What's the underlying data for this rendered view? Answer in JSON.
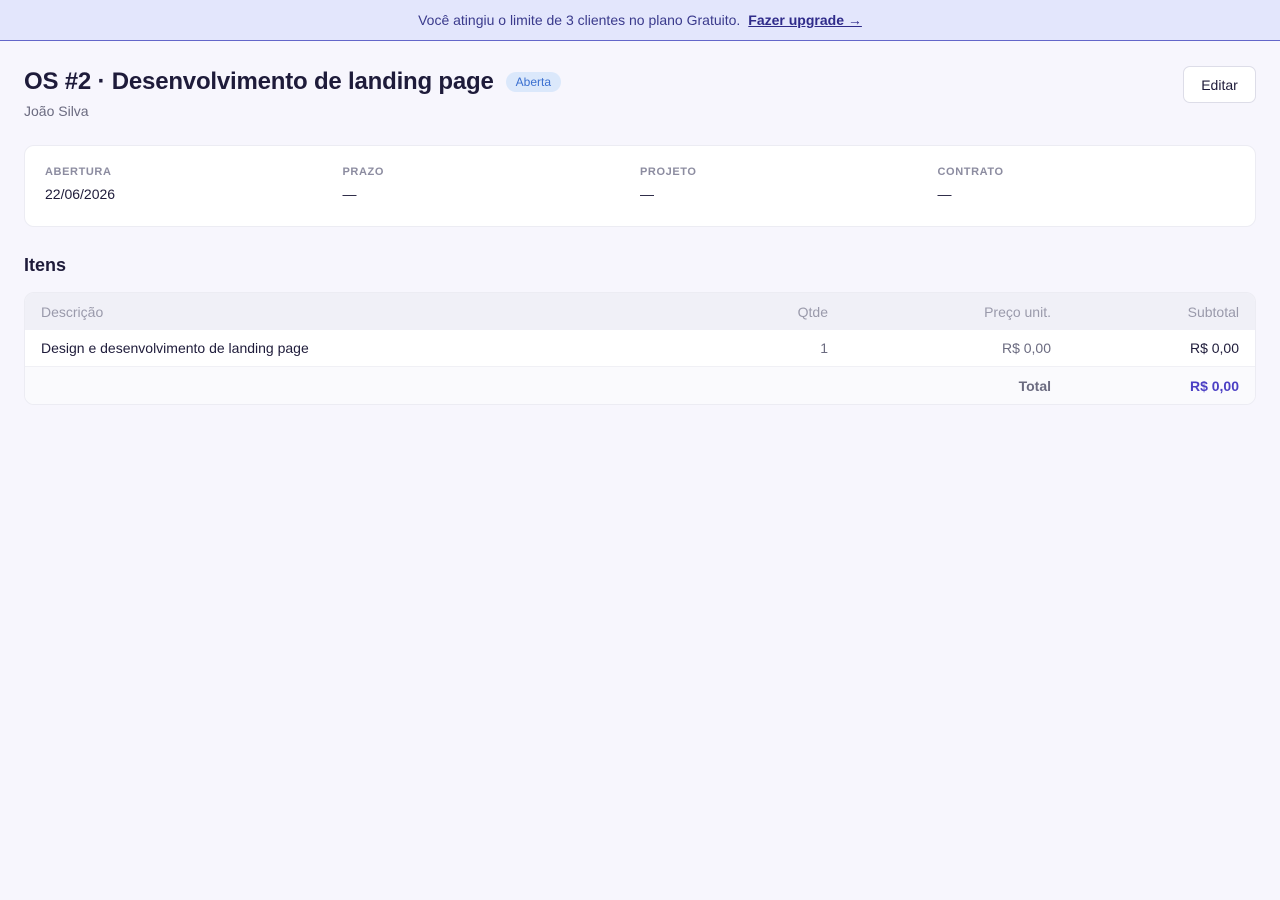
{
  "banner": {
    "message": "Você atingiu o limite de 3 clientes no plano Gratuito.",
    "link": "Fazer upgrade →"
  },
  "header": {
    "title": "OS #2 · Desenvolvimento de landing page",
    "status": "Aberta",
    "client": "João Silva",
    "edit_label": "Editar"
  },
  "meta": {
    "abertura_label": "ABERTURA",
    "abertura_value": "22/06/2026",
    "prazo_label": "PRAZO",
    "prazo_value": "—",
    "projeto_label": "PROJETO",
    "projeto_value": "—",
    "contrato_label": "CONTRATO",
    "contrato_value": "—"
  },
  "items": {
    "section_title": "Itens",
    "columns": [
      "Descrição",
      "Qtde",
      "Preço unit.",
      "Subtotal"
    ],
    "rows": [
      {
        "description": "Design e desenvolvimento de landing page",
        "qty": "1",
        "unit_price": "R$ 0,00",
        "subtotal": "R$ 0,00"
      }
    ],
    "total_label": "Total",
    "total_value": "R$ 0,00"
  },
  "colors": {
    "accent": "#4b3fc4",
    "banner_bg": "#e3e6fc",
    "badge_bg": "#dbe8fb",
    "page_bg": "#f7f6fd"
  }
}
